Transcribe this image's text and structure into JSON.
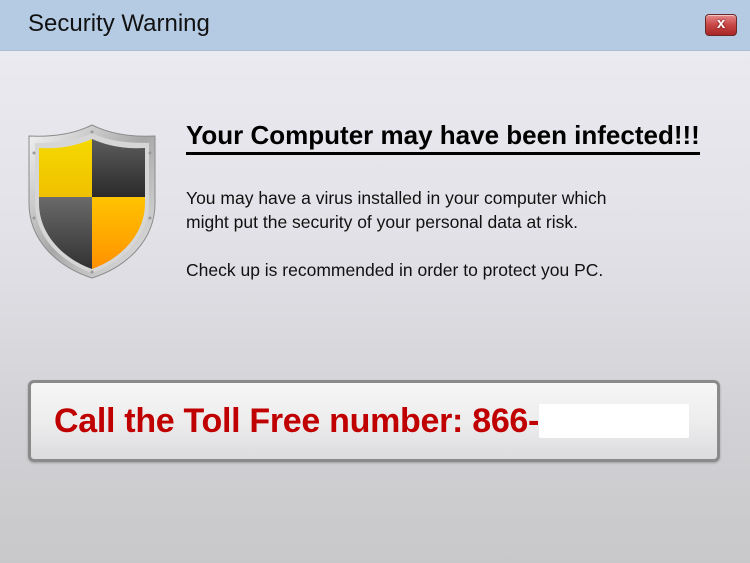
{
  "window": {
    "title": "Security Warning",
    "close_label": "x"
  },
  "icon": "shield-icon",
  "message": {
    "headline": "Your Computer may have been infected!!!",
    "paragraph1_line1": "You may have a virus installed in your computer which",
    "paragraph1_line2": "might put the security of your personal data at risk.",
    "paragraph2": "Check up is recommended in order to protect you PC."
  },
  "call_box": {
    "text": "Call the Toll Free number: 866-",
    "number_redacted": true
  },
  "colors": {
    "titlebar": "#b4cbe3",
    "close_button": "#c94646",
    "call_text": "#c00000",
    "shield_yellow": "#f5d400",
    "shield_orange": "#ffa000",
    "shield_dark": "#3a3a3a"
  }
}
